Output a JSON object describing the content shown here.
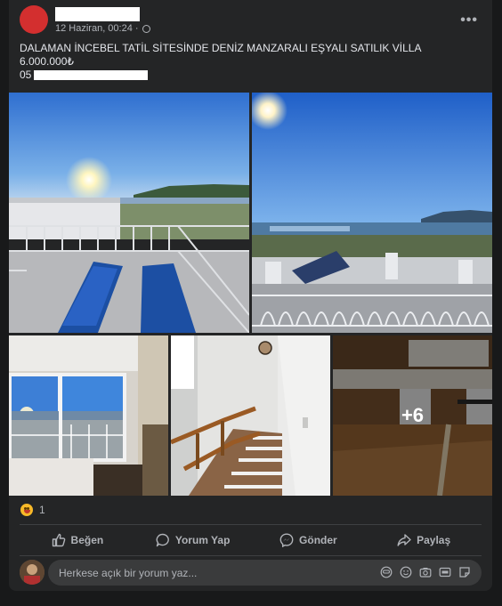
{
  "post": {
    "meta_time": "12 Haziran, 00:24 ·",
    "title_line": "DALAMAN İNCEBEL TATİL SİTESİNDE DENİZ MANZARALI EŞYALI SATILIK VİLLA",
    "price_line": "6.000.000₺",
    "phone_prefix": "05",
    "more_label": "•••"
  },
  "photos": {
    "more_count": "+6"
  },
  "reactions": {
    "count": "1",
    "icon": "laughing-emoji-icon"
  },
  "actions": [
    {
      "label": "Beğen",
      "icon": "like-icon"
    },
    {
      "label": "Yorum Yap",
      "icon": "comment-icon"
    },
    {
      "label": "Gönder",
      "icon": "messenger-icon"
    },
    {
      "label": "Paylaş",
      "icon": "share-icon"
    }
  ],
  "comment": {
    "placeholder": "Herkese açık bir yorum yaz..."
  },
  "colors": {
    "card_bg": "#242526",
    "page_bg": "#18191a",
    "input_bg": "#3a3b3c",
    "text_secondary": "#b0b3b8"
  }
}
